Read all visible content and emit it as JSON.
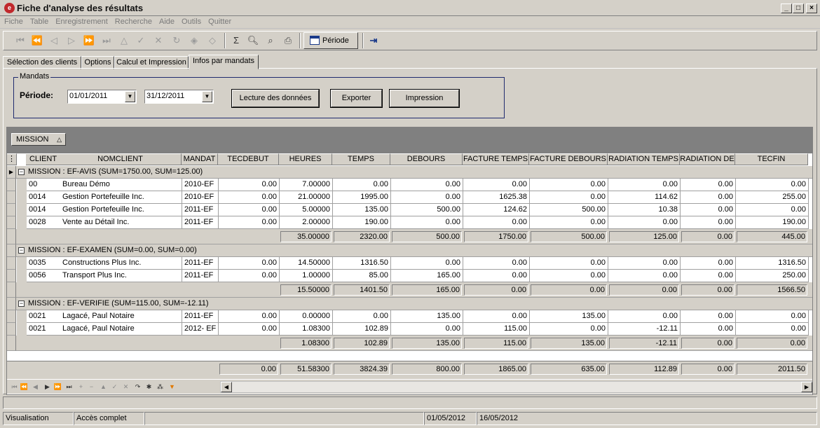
{
  "window": {
    "title": "Fiche d'analyse des résultats",
    "icon_letter": "e"
  },
  "menu": [
    "Fiche",
    "Table",
    "Enregistrement",
    "Recherche",
    "Aide",
    "Outils",
    "Quitter"
  ],
  "toolbar": {
    "periode_label": "Période"
  },
  "tabs": [
    "Sélection des clients",
    "Options",
    "Calcul et Impression",
    "Infos par mandats"
  ],
  "active_tab": 3,
  "mandats": {
    "legend": "Mandats",
    "periode_label": "Période:",
    "date_from": "01/01/2011",
    "date_to": "31/12/2011",
    "btn_lecture": "Lecture des données",
    "btn_exporter": "Exporter",
    "btn_impression": "Impression"
  },
  "group_by": {
    "label": "MISSION",
    "sort_icon": "△"
  },
  "columns": [
    "CLIENT",
    "NOMCLIENT",
    "MANDAT",
    "TECDEBUT",
    "HEURES",
    "TEMPS",
    "DEBOURS",
    "FACTURE TEMPS",
    "FACTURE DEBOURS",
    "RADIATION TEMPS",
    "RADIATION DE",
    "TECFIN"
  ],
  "groups": [
    {
      "label": "MISSION : EF-AVIS (SUM=1750.00, SUM=125.00)",
      "rows": [
        [
          "00",
          "Bureau Démo",
          "2010-EF",
          "0.00",
          "7.00000",
          "0.00",
          "0.00",
          "0.00",
          "0.00",
          "0.00",
          "0.00",
          "0.00"
        ],
        [
          "0014",
          "Gestion Portefeuille Inc.",
          "2010-EF",
          "0.00",
          "21.00000",
          "1995.00",
          "0.00",
          "1625.38",
          "0.00",
          "114.62",
          "0.00",
          "255.00"
        ],
        [
          "0014",
          "Gestion Portefeuille Inc.",
          "2011-EF",
          "0.00",
          "5.00000",
          "135.00",
          "500.00",
          "124.62",
          "500.00",
          "10.38",
          "0.00",
          "0.00"
        ],
        [
          "0028",
          "Vente au Détail Inc.",
          "2011-EF",
          "0.00",
          "2.00000",
          "190.00",
          "0.00",
          "0.00",
          "0.00",
          "0.00",
          "0.00",
          "190.00"
        ]
      ],
      "totals": [
        "35.00000",
        "2320.00",
        "500.00",
        "1750.00",
        "500.00",
        "125.00",
        "0.00",
        "445.00"
      ]
    },
    {
      "label": "MISSION : EF-EXAMEN (SUM=0.00, SUM=0.00)",
      "rows": [
        [
          "0035",
          "Constructions Plus  Inc.",
          "2011-EF",
          "0.00",
          "14.50000",
          "1316.50",
          "0.00",
          "0.00",
          "0.00",
          "0.00",
          "0.00",
          "1316.50"
        ],
        [
          "0056",
          "Transport Plus Inc.",
          "2011-EF",
          "0.00",
          "1.00000",
          "85.00",
          "165.00",
          "0.00",
          "0.00",
          "0.00",
          "0.00",
          "250.00"
        ]
      ],
      "totals": [
        "15.50000",
        "1401.50",
        "165.00",
        "0.00",
        "0.00",
        "0.00",
        "0.00",
        "1566.50"
      ]
    },
    {
      "label": "MISSION : EF-VERIFIE (SUM=115.00, SUM=-12.11)",
      "rows": [
        [
          "0021",
          "Lagacé, Paul Notaire",
          "2011-EF",
          "0.00",
          "0.00000",
          "0.00",
          "135.00",
          "0.00",
          "135.00",
          "0.00",
          "0.00",
          "0.00"
        ],
        [
          "0021",
          "Lagacé, Paul Notaire",
          "2012- EF",
          "0.00",
          "1.08300",
          "102.89",
          "0.00",
          "115.00",
          "0.00",
          "-12.11",
          "0.00",
          "0.00"
        ]
      ],
      "totals": [
        "1.08300",
        "102.89",
        "135.00",
        "115.00",
        "135.00",
        "-12.11",
        "0.00",
        "0.00"
      ]
    }
  ],
  "grand_totals": [
    "0.00",
    "51.58300",
    "3824.39",
    "800.00",
    "1865.00",
    "635.00",
    "112.89",
    "0.00",
    "2011.50"
  ],
  "status": {
    "mode": "Visualisation",
    "access": "Accès complet",
    "date1": "01/05/2012",
    "date2": "16/05/2012"
  }
}
